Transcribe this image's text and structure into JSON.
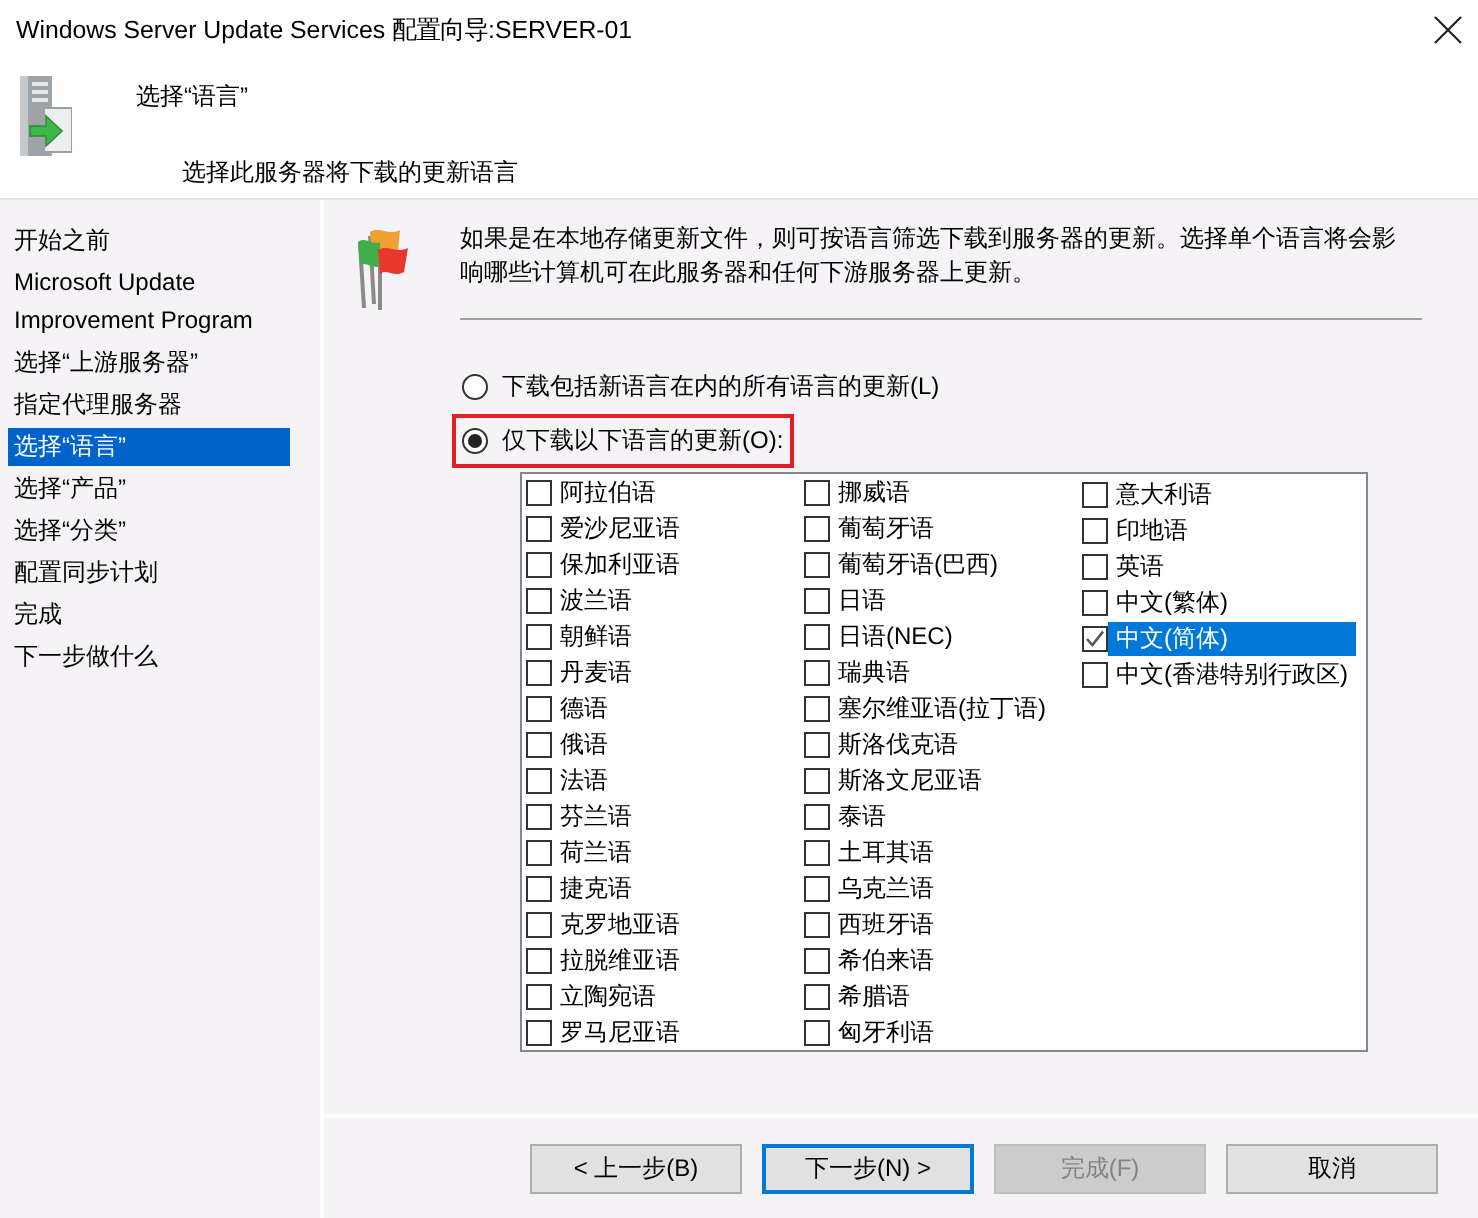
{
  "window": {
    "title": "Windows Server Update Services 配置向导:SERVER-01"
  },
  "header": {
    "title": "选择“语言”",
    "subtitle": "选择此服务器将下载的更新语言"
  },
  "sidebar": {
    "items": [
      {
        "label": "开始之前",
        "selected": false
      },
      {
        "label": "Microsoft Update Improvement Program",
        "selected": false
      },
      {
        "label": "选择“上游服务器”",
        "selected": false
      },
      {
        "label": "指定代理服务器",
        "selected": false
      },
      {
        "label": "选择“语言”",
        "selected": true
      },
      {
        "label": "选择“产品”",
        "selected": false
      },
      {
        "label": "选择“分类”",
        "selected": false
      },
      {
        "label": "配置同步计划",
        "selected": false
      },
      {
        "label": "完成",
        "selected": false
      },
      {
        "label": "下一步做什么",
        "selected": false
      }
    ]
  },
  "page": {
    "description": "如果是在本地存储更新文件，则可按语言筛选下载到服务器的更新。选择单个语言将会影响哪些计算机可在此服务器和任何下游服务器上更新。",
    "options": [
      {
        "label": "下载包括新语言在内的所有语言的更新(L)",
        "selected": false,
        "highlighted": false
      },
      {
        "label": "仅下载以下语言的更新(O):",
        "selected": true,
        "highlighted": true
      }
    ],
    "languages": {
      "columns": [
        [
          {
            "label": "阿拉伯语",
            "checked": false,
            "selected": false
          },
          {
            "label": "爱沙尼亚语",
            "checked": false,
            "selected": false
          },
          {
            "label": "保加利亚语",
            "checked": false,
            "selected": false
          },
          {
            "label": "波兰语",
            "checked": false,
            "selected": false
          },
          {
            "label": "朝鲜语",
            "checked": false,
            "selected": false
          },
          {
            "label": "丹麦语",
            "checked": false,
            "selected": false
          },
          {
            "label": "德语",
            "checked": false,
            "selected": false
          },
          {
            "label": "俄语",
            "checked": false,
            "selected": false
          },
          {
            "label": "法语",
            "checked": false,
            "selected": false
          },
          {
            "label": "芬兰语",
            "checked": false,
            "selected": false
          },
          {
            "label": "荷兰语",
            "checked": false,
            "selected": false
          },
          {
            "label": "捷克语",
            "checked": false,
            "selected": false
          },
          {
            "label": "克罗地亚语",
            "checked": false,
            "selected": false
          },
          {
            "label": "拉脱维亚语",
            "checked": false,
            "selected": false
          },
          {
            "label": "立陶宛语",
            "checked": false,
            "selected": false
          },
          {
            "label": "罗马尼亚语",
            "checked": false,
            "selected": false
          }
        ],
        [
          {
            "label": "挪威语",
            "checked": false,
            "selected": false
          },
          {
            "label": "葡萄牙语",
            "checked": false,
            "selected": false
          },
          {
            "label": "葡萄牙语(巴西)",
            "checked": false,
            "selected": false
          },
          {
            "label": "日语",
            "checked": false,
            "selected": false
          },
          {
            "label": "日语(NEC)",
            "checked": false,
            "selected": false
          },
          {
            "label": "瑞典语",
            "checked": false,
            "selected": false
          },
          {
            "label": "塞尔维亚语(拉丁语)",
            "checked": false,
            "selected": false
          },
          {
            "label": "斯洛伐克语",
            "checked": false,
            "selected": false
          },
          {
            "label": "斯洛文尼亚语",
            "checked": false,
            "selected": false
          },
          {
            "label": "泰语",
            "checked": false,
            "selected": false
          },
          {
            "label": "土耳其语",
            "checked": false,
            "selected": false
          },
          {
            "label": "乌克兰语",
            "checked": false,
            "selected": false
          },
          {
            "label": "西班牙语",
            "checked": false,
            "selected": false
          },
          {
            "label": "希伯来语",
            "checked": false,
            "selected": false
          },
          {
            "label": "希腊语",
            "checked": false,
            "selected": false
          },
          {
            "label": "匈牙利语",
            "checked": false,
            "selected": false
          }
        ],
        [
          {
            "label": "意大利语",
            "checked": false,
            "selected": false
          },
          {
            "label": "印地语",
            "checked": false,
            "selected": false
          },
          {
            "label": "英语",
            "checked": false,
            "selected": false
          },
          {
            "label": "中文(繁体)",
            "checked": false,
            "selected": false
          },
          {
            "label": "中文(简体)",
            "checked": true,
            "selected": true
          },
          {
            "label": "中文(香港特别行政区)",
            "checked": false,
            "selected": false
          }
        ]
      ]
    }
  },
  "buttons": [
    {
      "label": "< 上一步(B)",
      "focused": false,
      "disabled": false
    },
    {
      "label": "下一步(N) >",
      "focused": true,
      "disabled": false
    },
    {
      "label": "完成(F)",
      "focused": false,
      "disabled": true
    },
    {
      "label": "取消",
      "focused": false,
      "disabled": false
    }
  ]
}
